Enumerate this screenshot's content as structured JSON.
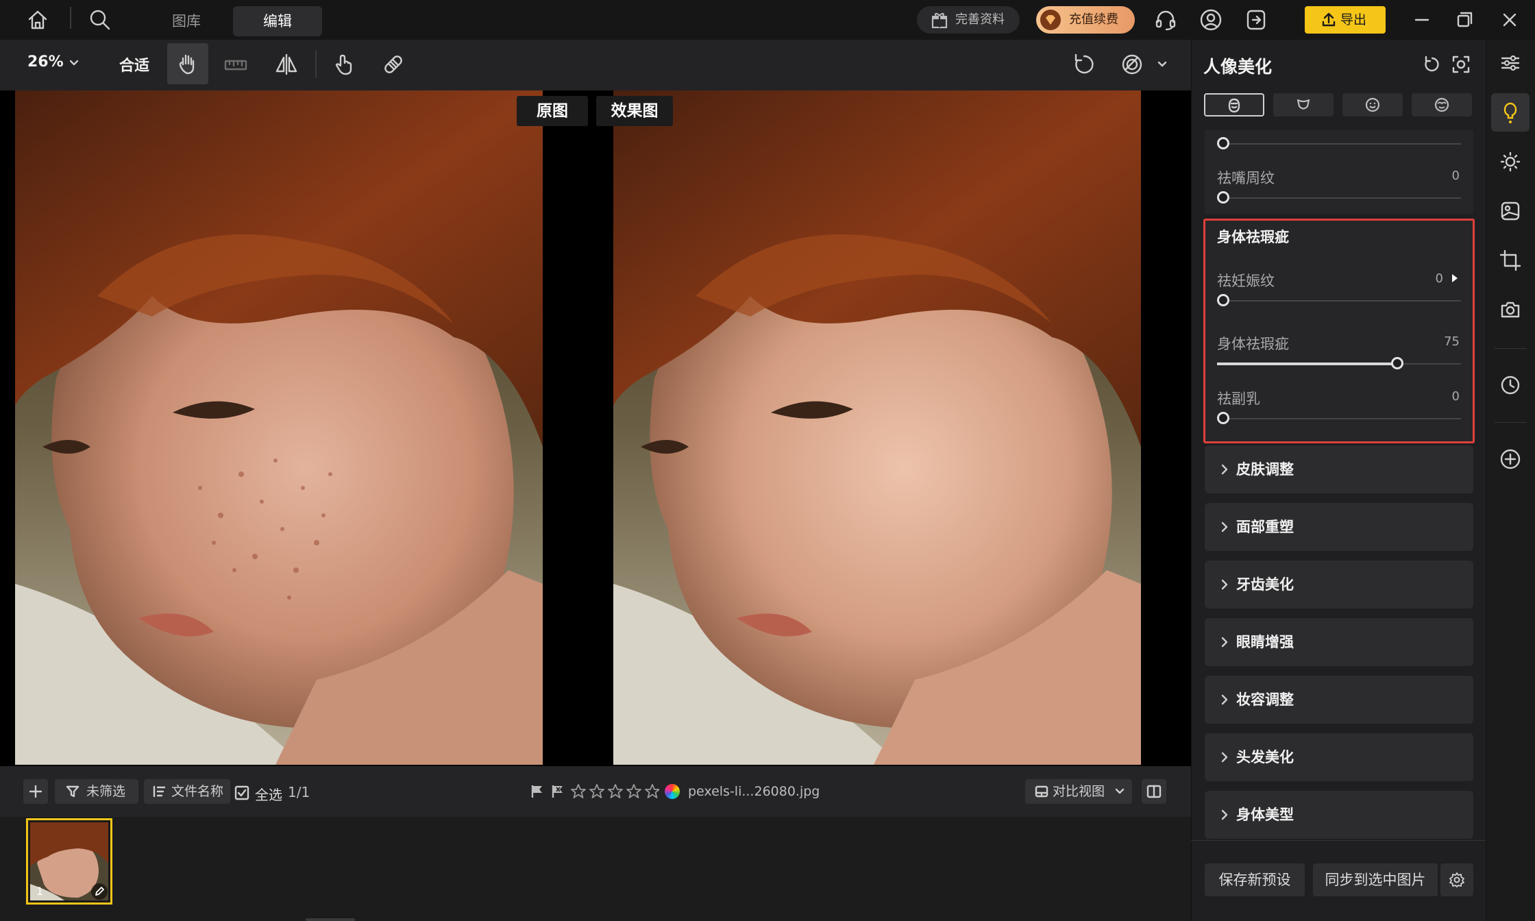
{
  "topbar": {
    "tabs": [
      "图库",
      "编辑"
    ],
    "active_tab": "编辑",
    "complete_profile": "完善资料",
    "recharge": "充值续费",
    "export": "导出"
  },
  "toolbar": {
    "zoom": "26%",
    "fit": "合适"
  },
  "canvas": {
    "label_original": "原图",
    "label_result": "效果图"
  },
  "filmstrip": {
    "unfiltered": "未筛选",
    "sort_filename": "文件名称",
    "select_all": "全选",
    "count": "1/1",
    "filename": "pexels-li...26080.jpg",
    "compare_view": "对比视图",
    "thumb_index": "1"
  },
  "panel": {
    "title": "人像美化",
    "slider_mouth": {
      "label": "祛嘴周纹",
      "value": "0",
      "fraction": 0
    },
    "group_title": "身体祛瑕疵",
    "slider_stretch": {
      "label": "祛妊娠纹",
      "value": "0",
      "fraction": 0
    },
    "slider_body": {
      "label": "身体祛瑕疵",
      "value": "75",
      "fraction": 0.75
    },
    "slider_breast": {
      "label": "祛副乳",
      "value": "0",
      "fraction": 0
    },
    "sections": [
      "皮肤调整",
      "面部重塑",
      "牙齿美化",
      "眼睛增强",
      "妆容调整",
      "头发美化",
      "身体美型"
    ],
    "save_preset": "保存新预设",
    "sync_selected": "同步到选中图片"
  },
  "colors": {
    "accent": "#f5c518",
    "highlight_border": "#e0403a",
    "background": "#1d1d1f"
  }
}
